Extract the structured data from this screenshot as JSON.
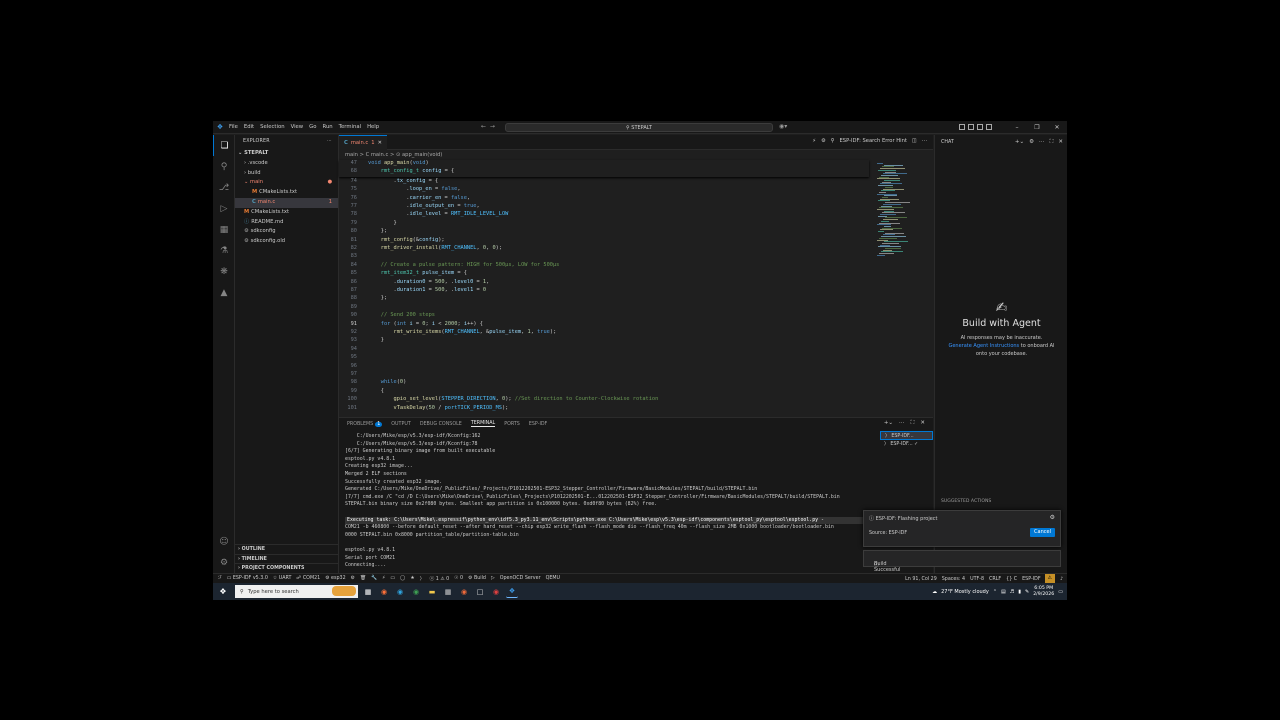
{
  "titlebar": {
    "menus": [
      "File",
      "Edit",
      "Selection",
      "View",
      "Go",
      "Run",
      "Terminal",
      "Help"
    ],
    "search_text": "STEPALT"
  },
  "sidebar": {
    "title": "EXPLORER",
    "root": "STEPALT",
    "items": [
      {
        "label": ".vscode",
        "level": 1,
        "kind": "folder"
      },
      {
        "label": "build",
        "level": 1,
        "kind": "folder"
      },
      {
        "label": "main",
        "level": 1,
        "kind": "folder",
        "modified": true
      },
      {
        "label": "CMakeLists.txt",
        "level": 2,
        "kind": "cmake"
      },
      {
        "label": "main.c",
        "level": 2,
        "kind": "c",
        "modified": true,
        "selected": true,
        "badge": "1"
      },
      {
        "label": "CMakeLists.txt",
        "level": 1,
        "kind": "cmake"
      },
      {
        "label": "README.md",
        "level": 1,
        "kind": "info"
      },
      {
        "label": "sdkconfig",
        "level": 1,
        "kind": "gear"
      },
      {
        "label": "sdkconfig.old",
        "level": 1,
        "kind": "gear"
      }
    ],
    "sections": [
      "OUTLINE",
      "TIMELINE",
      "PROJECT COMPONENTS"
    ]
  },
  "editor": {
    "tab_label": "main.c",
    "tab_badge": "1",
    "breadcrumb": "main  >  C  main.c  >  ⊙ app_main(void)",
    "search_error_hint": "ESP-IDF: Search Error Hint",
    "lines": [
      {
        "n": "47",
        "html": "<span class='kw'>void</span> <span class='fn'>app_main</span>(<span class='kw'>void</span>)",
        "sticky": true
      },
      {
        "n": "68",
        "html": "    <span class='ty'>rmt_config_t</span> <span class='vr'>config</span> = {",
        "sticky": true
      },
      {
        "n": "74",
        "html": "        .<span class='vr'>tx_config</span> = {"
      },
      {
        "n": "75",
        "html": "            .<span class='vr'>loop_en</span> = <span class='kw'>false</span>,"
      },
      {
        "n": "76",
        "html": "            .<span class='vr'>carrier_en</span> = <span class='kw'>false</span>,"
      },
      {
        "n": "77",
        "html": "            .<span class='vr'>idle_output_en</span> = <span class='kw'>true</span>,"
      },
      {
        "n": "78",
        "html": "            .<span class='vr'>idle_level</span> = <span class='mc'>RMT_IDLE_LEVEL_LOW</span>"
      },
      {
        "n": "79",
        "html": "        }"
      },
      {
        "n": "80",
        "html": "    };"
      },
      {
        "n": "81",
        "html": "    <span class='fn'>rmt_config</span>(&amp;<span class='vr'>config</span>);"
      },
      {
        "n": "82",
        "html": "    <span class='fn'>rmt_driver_install</span>(<span class='mc'>RMT_CHANNEL</span>, <span class='nm'>0</span>, <span class='nm'>0</span>);"
      },
      {
        "n": "83",
        "html": ""
      },
      {
        "n": "84",
        "html": "    <span class='cm'>// Create a pulse pattern: HIGH for 500µs, LOW for 500µs</span>"
      },
      {
        "n": "85",
        "html": "    <span class='ty'>rmt_item32_t</span> <span class='vr'>pulse_item</span> = {"
      },
      {
        "n": "86",
        "html": "        .<span class='vr'>duration0</span> = <span class='nm'>500</span>, .<span class='vr'>level0</span> = <span class='nm'>1</span>,"
      },
      {
        "n": "87",
        "html": "        .<span class='vr'>duration1</span> = <span class='nm'>500</span>, .<span class='vr'>level1</span> = <span class='nm'>0</span>"
      },
      {
        "n": "88",
        "html": "    };"
      },
      {
        "n": "89",
        "html": ""
      },
      {
        "n": "90",
        "html": "    <span class='cm'>// Send 200 steps</span>"
      },
      {
        "n": "91",
        "html": "    <span class='kw'>for</span> (<span class='kw'>int</span> <span class='vr'>i</span> = <span class='nm'>0</span>; <span class='vr'>i</span> &lt; <span class='nm'>2000</span>; <span class='vr'>i</span>++) {",
        "current": true
      },
      {
        "n": "92",
        "html": "        <span class='fn'>rmt_write_items</span>(<span class='mc'>RMT_CHANNEL</span>, &amp;<span class='vr'>pulse_item</span>, <span class='nm'>1</span>, <span class='kw'>true</span>);"
      },
      {
        "n": "93",
        "html": "    }"
      },
      {
        "n": "94",
        "html": ""
      },
      {
        "n": "95",
        "html": ""
      },
      {
        "n": "96",
        "html": ""
      },
      {
        "n": "97",
        "html": ""
      },
      {
        "n": "98",
        "html": "    <span class='kw'>while</span>(<span class='nm'>0</span>)"
      },
      {
        "n": "99",
        "html": "    {"
      },
      {
        "n": "100",
        "html": "        <span class='fn'>gpio_set_level</span>(<span class='mc'>STEPPER_DIRECTION</span>, <span class='nm'>0</span>); <span class='cm'>//Set direction to Counter-Clockwise rotation</span>"
      },
      {
        "n": "101",
        "html": "        <span class='fn'>vTaskDelay</span>(<span class='nm'>50</span> / <span class='mc'>portTICK_PERIOD_MS</span>);"
      }
    ]
  },
  "panel": {
    "tabs": [
      "PROBLEMS",
      "OUTPUT",
      "DEBUG CONSOLE",
      "TERMINAL",
      "PORTS",
      "ESP-IDF"
    ],
    "problems_count": "1",
    "active_tab": "TERMINAL",
    "terminal_lines": [
      "    C:/Users/Mike/esp/v5.3/esp-idf/Kconfig:162",
      "    C:/Users/Mike/esp/v5.3/esp-idf/Kconfig:78",
      "[6/7] Generating binary image from built executable",
      "esptool.py v4.8.1",
      "Creating esp32 image...",
      "Merged 2 ELF sections",
      "Successfully created esp32 image.",
      "Generated C:/Users/Mike/OneDrive/_PublicFiles/_Projects/P1012202501-ESP32_Stepper_Controller/Firmware/BasicModules/STEPALT/build/STEPALT.bin",
      "[7/7] cmd.exe /C \"cd /D C:\\Users\\Mike\\OneDrive\\_PublicFiles\\_Projects\\P1012202501-E...012202501-ESP32_Stepper_Controller/Firmware/BasicModules/STEPALT/build/STEPALT.bin",
      "STEPALT.bin binary size 0x2f080 bytes. Smallest app partition is 0x100000 bytes. 0xd0f80 bytes (82%) free.",
      "",
      "Executing task: C:\\Users\\Mike\\.espressif\\python_env\\idf5.3_py3.11_env\\Scripts\\python.exe C:\\Users\\Mike\\esp\\v5.3\\esp-idf\\components\\esptool_py\\esptool\\esptool.py -",
      "COM21 -b 460800 --before default_reset --after hard_reset --chip esp32 write_flash --flash_mode dio --flash_freq 40m --flash_size 2MB 0x1000 bootloader/bootloader.bin",
      "0000 STEPALT.bin 0x8000 partition_table/partition-table.bin",
      "",
      "esptool.py v4.8.1",
      "Serial port COM21",
      "Connecting...."
    ],
    "terminals": [
      "ESP-IDF...",
      "ESP-IDF..."
    ]
  },
  "chat": {
    "title": "CHAT",
    "heading": "Build with Agent",
    "line1": "AI responses may be inaccurate.",
    "link": "Generate Agent Instructions",
    "line2": " to onboard AI",
    "line3": "onto your codebase.",
    "suggested": "SUGGESTED ACTIONS"
  },
  "notifications": {
    "flash_title": "ESP-IDF: Flashing project",
    "flash_source": "Source: ESP-IDF",
    "cancel": "Cancel",
    "build": "Build Successful"
  },
  "statusbar": {
    "left": [
      "ESP-IDF v5.3.0",
      "UART",
      "COM21",
      "esp32",
      "ⓧ 1 ⚠ 0",
      "☉ 0",
      "Build",
      "OpenOCD Server",
      "QEMU"
    ],
    "right": [
      "Ln 91, Col 29",
      "Spaces: 4",
      "UTF-8",
      "CRLF",
      "{} C",
      "ESP-IDF"
    ]
  },
  "taskbar": {
    "search_placeholder": "Type here to search",
    "weather": "27°F  Mostly cloudy",
    "time": "6:05 PM",
    "date": "2/9/2026"
  },
  "colors": {
    "accent": "#0078d4",
    "editor_bg": "#1f1f1f",
    "sidebar_bg": "#181818"
  }
}
